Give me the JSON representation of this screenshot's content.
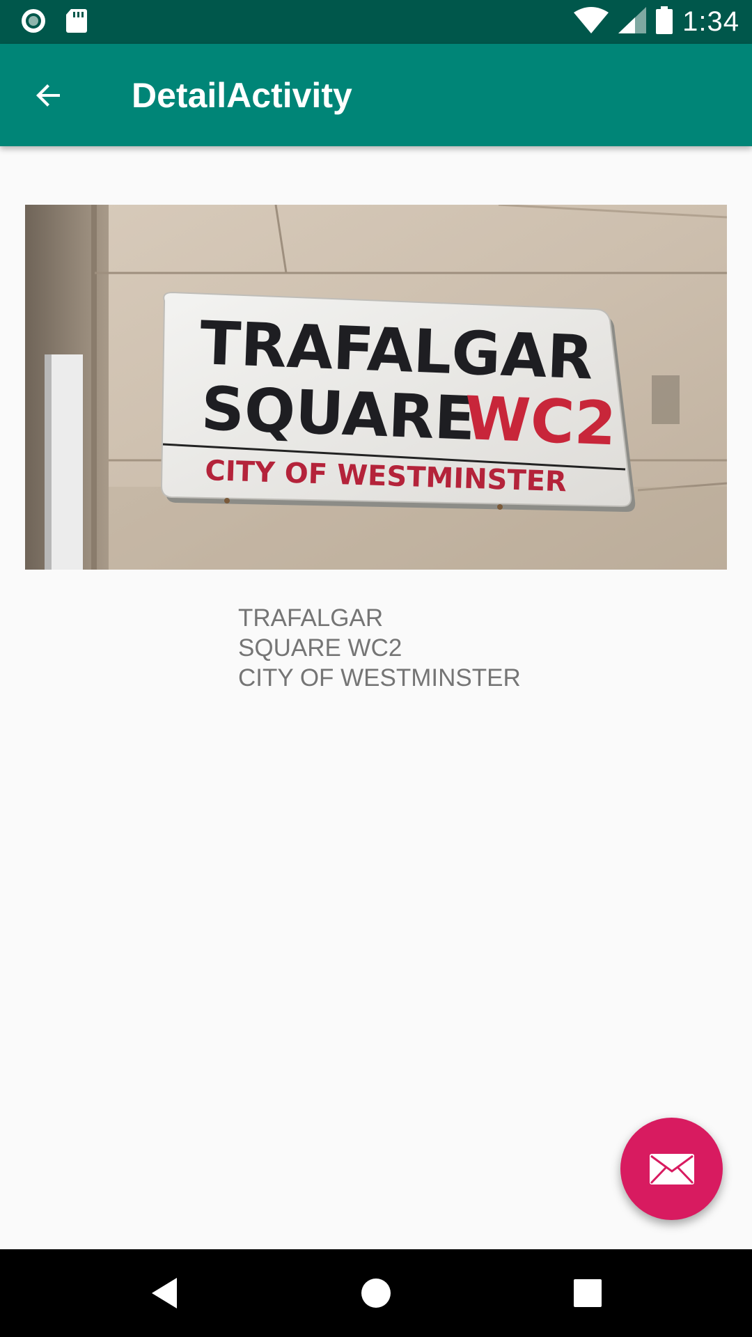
{
  "status_bar": {
    "time": "1:34",
    "icons": [
      "record-icon",
      "sd-card-icon",
      "wifi-icon",
      "cell-signal-icon",
      "battery-icon"
    ],
    "background": "#00574b"
  },
  "app_bar": {
    "title": "DetailActivity",
    "back_icon": "arrow-back-icon",
    "background": "#008577"
  },
  "photo": {
    "sign_line1": "TRAFALGAR",
    "sign_line2": "SQUARE",
    "sign_postcode": "WC2",
    "sign_line3": "CITY OF WESTMINSTER"
  },
  "detail": {
    "lines": [
      "TRAFALGAR",
      "SQUARE WC2",
      "CITY OF WESTMINSTER"
    ]
  },
  "fab": {
    "icon": "email-icon",
    "color": "#d81b60"
  },
  "nav_bar": {
    "icons": [
      "nav-back-icon",
      "nav-home-icon",
      "nav-recents-icon"
    ]
  }
}
